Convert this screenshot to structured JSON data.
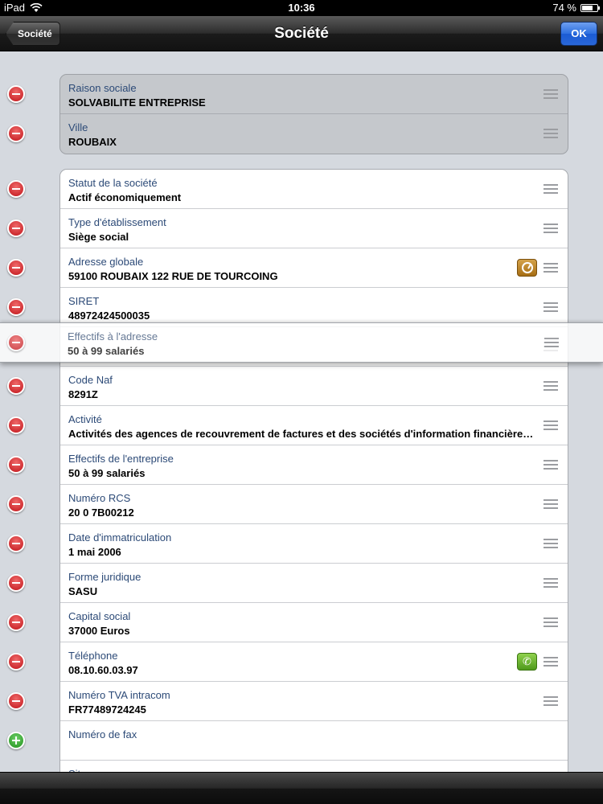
{
  "status_bar": {
    "device": "iPad",
    "time": "10:36",
    "battery": "74 %",
    "battery_level": 0.74
  },
  "nav": {
    "back_label": "Société",
    "title": "Société",
    "ok_label": "OK"
  },
  "group_top": [
    {
      "label": "Raison sociale",
      "value": "SOLVABILITE ENTREPRISE"
    },
    {
      "label": "Ville",
      "value": "ROUBAIX"
    }
  ],
  "group_main": [
    {
      "label": "Statut de la société",
      "value": "Actif économiquement"
    },
    {
      "label": "Type d'établissement",
      "value": "Siège social"
    },
    {
      "label": "Adresse globale",
      "value": "59100 ROUBAIX 122 RUE DE TOURCOING"
    },
    {
      "label": "SIRET",
      "value": "48972424500035"
    },
    {
      "label": "",
      "value": ""
    },
    {
      "label": "Code Naf",
      "value": "8291Z"
    },
    {
      "label": "Activité",
      "value": "Activités des agences de recouvrement de factures et des sociétés d'information financière sur la clientèle"
    },
    {
      "label": "Effectifs de l'entreprise",
      "value": "50 à 99 salariés"
    },
    {
      "label": "Numéro RCS",
      "value": "20 0 7B00212"
    },
    {
      "label": "Date d'immatriculation",
      "value": "1 mai 2006"
    },
    {
      "label": "Forme juridique",
      "value": "SASU"
    },
    {
      "label": "Capital social",
      "value": "37000 Euros"
    },
    {
      "label": "Téléphone",
      "value": "08.10.60.03.97"
    },
    {
      "label": "Numéro TVA intracom",
      "value": "FR77489724245"
    },
    {
      "label": "Numéro de fax",
      "value": ""
    },
    {
      "label": "Site",
      "value": ""
    }
  ],
  "dragged_row": {
    "label": "Effectifs à l'adresse",
    "value": "50 à 99 salariés"
  },
  "icons": {
    "delete": "minus-circle-icon",
    "add": "plus-circle-icon",
    "reorder": "reorder-grip-icon",
    "address_action": "clock-icon",
    "phone_action": "phone-icon",
    "wifi": "wifi-icon"
  },
  "colors": {
    "delete": "#c0141a",
    "add": "#1f8f1a",
    "ok_button": "#2d6fe0",
    "label_text": "#2c4a77"
  }
}
